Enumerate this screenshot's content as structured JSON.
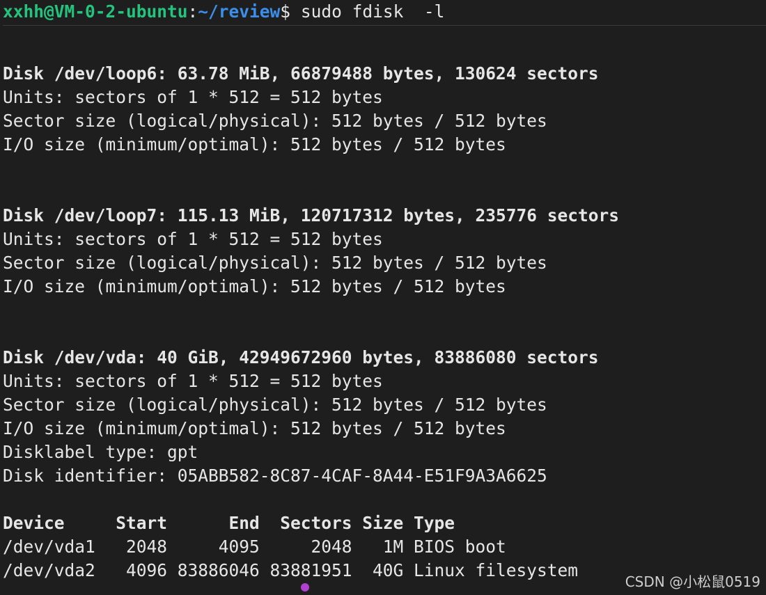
{
  "prompt": {
    "user_host": "xxhh@VM-0-2-ubuntu",
    "colon": ":",
    "path": "~/review",
    "dollar": "$",
    "command": " sudo fdisk  -l"
  },
  "disks": [
    {
      "header": "Disk /dev/loop6: 63.78 MiB, 66879488 bytes, 130624 sectors",
      "units": "Units: sectors of 1 * 512 = 512 bytes",
      "sector_size": "Sector size (logical/physical): 512 bytes / 512 bytes",
      "io_size": "I/O size (minimum/optimal): 512 bytes / 512 bytes"
    },
    {
      "header": "Disk /dev/loop7: 115.13 MiB, 120717312 bytes, 235776 sectors",
      "units": "Units: sectors of 1 * 512 = 512 bytes",
      "sector_size": "Sector size (logical/physical): 512 bytes / 512 bytes",
      "io_size": "I/O size (minimum/optimal): 512 bytes / 512 bytes"
    },
    {
      "header": "Disk /dev/vda: 40 GiB, 42949672960 bytes, 83886080 sectors",
      "units": "Units: sectors of 1 * 512 = 512 bytes",
      "sector_size": "Sector size (logical/physical): 512 bytes / 512 bytes",
      "io_size": "I/O size (minimum/optimal): 512 bytes / 512 bytes",
      "disklabel": "Disklabel type: gpt",
      "identifier": "Disk identifier: 05ABB582-8C87-4CAF-8A44-E51F9A3A6625"
    }
  ],
  "partition_table": {
    "header": "Device     Start      End  Sectors Size Type",
    "rows": [
      "/dev/vda1   2048     4095     2048   1M BIOS boot",
      "/dev/vda2   4096 83886046 83881951  40G Linux filesystem"
    ]
  },
  "watermark": "CSDN @小松鼠0519",
  "colors": {
    "background": "#1e1e1e",
    "user_host": "#24c47e",
    "path": "#3b8eea",
    "text": "#e6e6e6"
  }
}
